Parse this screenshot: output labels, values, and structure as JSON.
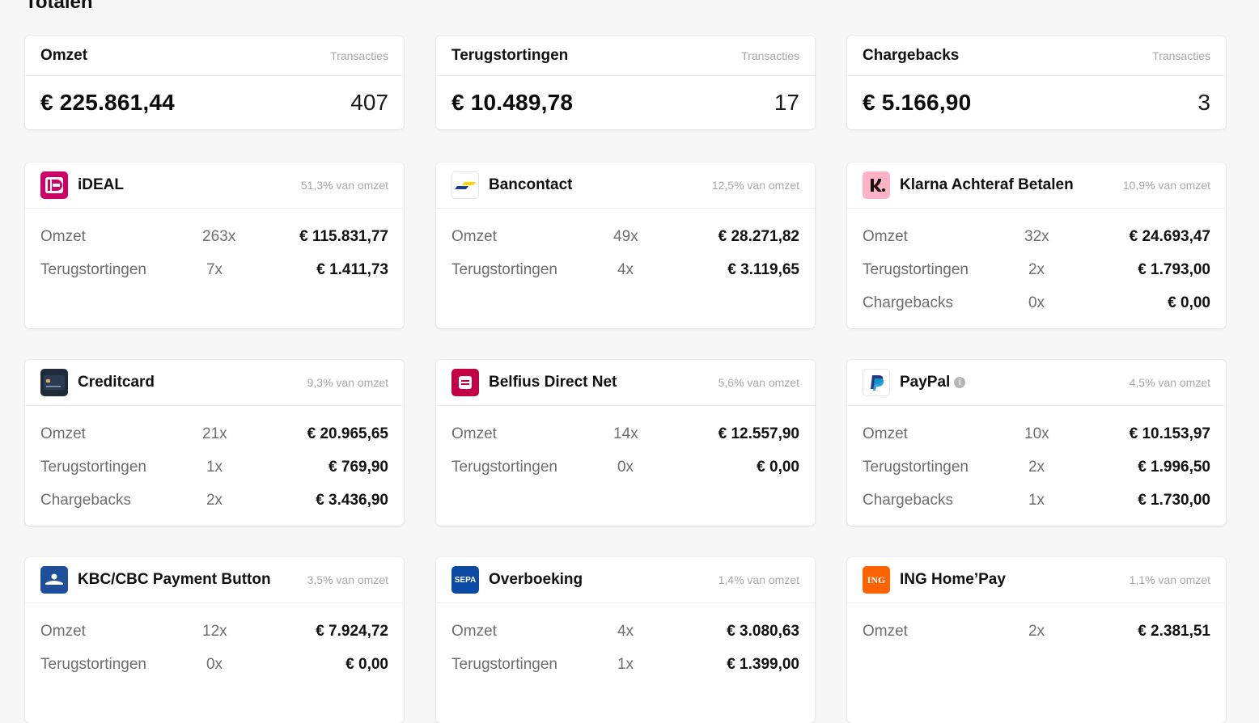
{
  "page_title": "Totalen",
  "totals": [
    {
      "title": "Omzet",
      "sub": "Transacties",
      "amount": "€ 225.861,44",
      "count": "407"
    },
    {
      "title": "Terugstortingen",
      "sub": "Transacties",
      "amount": "€ 10.489,78",
      "count": "17"
    },
    {
      "title": "Chargebacks",
      "sub": "Transacties",
      "amount": "€ 5.166,90",
      "count": "3"
    }
  ],
  "methods": [
    {
      "name": "iDEAL",
      "share": "51,3% van omzet",
      "icon": "ideal-icon",
      "rows": [
        {
          "label": "Omzet",
          "count": "263x",
          "amount": "€ 115.831,77"
        },
        {
          "label": "Terugstortingen",
          "count": "7x",
          "amount": "€ 1.411,73"
        }
      ]
    },
    {
      "name": "Bancontact",
      "share": "12,5% van omzet",
      "icon": "bancontact-icon",
      "rows": [
        {
          "label": "Omzet",
          "count": "49x",
          "amount": "€ 28.271,82"
        },
        {
          "label": "Terugstortingen",
          "count": "4x",
          "amount": "€ 3.119,65"
        }
      ]
    },
    {
      "name": "Klarna Achteraf Betalen",
      "share": "10,9% van omzet",
      "icon": "klarna-icon",
      "rows": [
        {
          "label": "Omzet",
          "count": "32x",
          "amount": "€ 24.693,47"
        },
        {
          "label": "Terugstortingen",
          "count": "2x",
          "amount": "€ 1.793,00"
        },
        {
          "label": "Chargebacks",
          "count": "0x",
          "amount": "€ 0,00"
        }
      ]
    },
    {
      "name": "Creditcard",
      "share": "9,3% van omzet",
      "icon": "creditcard-icon",
      "rows": [
        {
          "label": "Omzet",
          "count": "21x",
          "amount": "€ 20.965,65"
        },
        {
          "label": "Terugstortingen",
          "count": "1x",
          "amount": "€ 769,90"
        },
        {
          "label": "Chargebacks",
          "count": "2x",
          "amount": "€ 3.436,90"
        }
      ]
    },
    {
      "name": "Belfius Direct Net",
      "share": "5,6% van omzet",
      "icon": "belfius-icon",
      "rows": [
        {
          "label": "Omzet",
          "count": "14x",
          "amount": "€ 12.557,90"
        },
        {
          "label": "Terugstortingen",
          "count": "0x",
          "amount": "€ 0,00"
        }
      ]
    },
    {
      "name": "PayPal",
      "share": "4,5% van omzet",
      "icon": "paypal-icon",
      "info": "i",
      "rows": [
        {
          "label": "Omzet",
          "count": "10x",
          "amount": "€ 10.153,97"
        },
        {
          "label": "Terugstortingen",
          "count": "2x",
          "amount": "€ 1.996,50"
        },
        {
          "label": "Chargebacks",
          "count": "1x",
          "amount": "€ 1.730,00"
        }
      ]
    },
    {
      "name": "KBC/CBC Payment Button",
      "share": "3,5% van omzet",
      "icon": "kbc-icon",
      "rows": [
        {
          "label": "Omzet",
          "count": "12x",
          "amount": "€ 7.924,72"
        },
        {
          "label": "Terugstortingen",
          "count": "0x",
          "amount": "€ 0,00"
        }
      ]
    },
    {
      "name": "Overboeking",
      "share": "1,4% van omzet",
      "icon": "sepa-icon",
      "logo_text": "SEPA",
      "rows": [
        {
          "label": "Omzet",
          "count": "4x",
          "amount": "€ 3.080,63"
        },
        {
          "label": "Terugstortingen",
          "count": "1x",
          "amount": "€ 1.399,00"
        }
      ]
    },
    {
      "name": "ING Home’Pay",
      "share": "1,1% van omzet",
      "icon": "ing-icon",
      "logo_text": "ING",
      "rows": [
        {
          "label": "Omzet",
          "count": "2x",
          "amount": "€ 2.381,51"
        }
      ]
    }
  ],
  "colors": {
    "ideal": "#cc0066",
    "bancontact_blue": "#1e3c8c",
    "bancontact_yellow": "#ffd800",
    "klarna": "#ffb3c7",
    "belfius": "#c30045",
    "kbc": "#1f4e9a",
    "sepa": "#0a4aa3",
    "ing": "#ff6200"
  }
}
